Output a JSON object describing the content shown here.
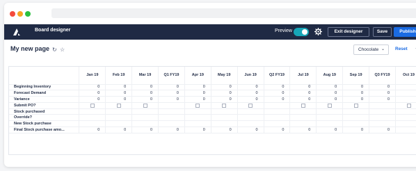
{
  "app": {
    "name": "Board designer",
    "preview_label": "Preview",
    "preview_on": true,
    "exit_label": "Exit designer",
    "save_label": "Save",
    "publish_label": "Publish"
  },
  "page": {
    "title": "My new page",
    "scenario": "Chocolate",
    "reset_label": "Reset"
  },
  "table": {
    "columns": [
      "Jan 19",
      "Feb 19",
      "Mar 19",
      "Q1 FY19",
      "Apr 19",
      "May 19",
      "Jun 19",
      "Q2 FY19",
      "Jul 19",
      "Aug 19",
      "Sep 19",
      "Q3 FY19",
      "Oct 19"
    ],
    "rows": [
      {
        "label": "Beginning Inventory",
        "kind": "num",
        "cells": [
          "0",
          "0",
          "0",
          "0",
          "0",
          "0",
          "0",
          "0",
          "0",
          "0",
          "0",
          "0",
          ""
        ]
      },
      {
        "label": "Forecast Demand",
        "kind": "num",
        "cells": [
          "0",
          "0",
          "0",
          "0",
          "0",
          "0",
          "0",
          "0",
          "0",
          "0",
          "0",
          "0",
          ""
        ]
      },
      {
        "label": "Variance",
        "kind": "num",
        "cells": [
          "0",
          "0",
          "0",
          "0",
          "0",
          "0",
          "0",
          "0",
          "0",
          "0",
          "0",
          "0",
          ""
        ]
      },
      {
        "label": "Submit PO?",
        "kind": "chk",
        "cells": [
          true,
          true,
          true,
          false,
          true,
          true,
          true,
          false,
          true,
          true,
          true,
          false,
          true
        ]
      },
      {
        "label": "Stock purchased",
        "kind": "num",
        "cells": [
          "",
          "",
          "",
          "",
          "",
          "",
          "",
          "",
          "",
          "",
          "",
          "",
          ""
        ]
      },
      {
        "label": "Override?",
        "kind": "num",
        "cells": [
          "",
          "",
          "",
          "",
          "",
          "",
          "",
          "",
          "",
          "",
          "",
          "",
          ""
        ]
      },
      {
        "label": "New Stock purchase",
        "kind": "num",
        "cells": [
          "",
          "",
          "",
          "",
          "",
          "",
          "",
          "",
          "",
          "",
          "",
          "",
          ""
        ]
      },
      {
        "label": "Final Stock purchase amo...",
        "kind": "num",
        "cells": [
          "0",
          "0",
          "0",
          "0",
          "0",
          "0",
          "0",
          "0",
          "0",
          "0",
          "0",
          "0",
          ""
        ]
      }
    ]
  },
  "icons": {
    "logo": "board-logo-icon",
    "settings": "gear-icon",
    "refresh": "sync-icon",
    "favorite": "star-icon",
    "dropdown": "chevron-down-icon"
  },
  "colors": {
    "appbar": "#1f2a44",
    "accent": "#1a6be3",
    "toggle": "#17a6b8"
  }
}
